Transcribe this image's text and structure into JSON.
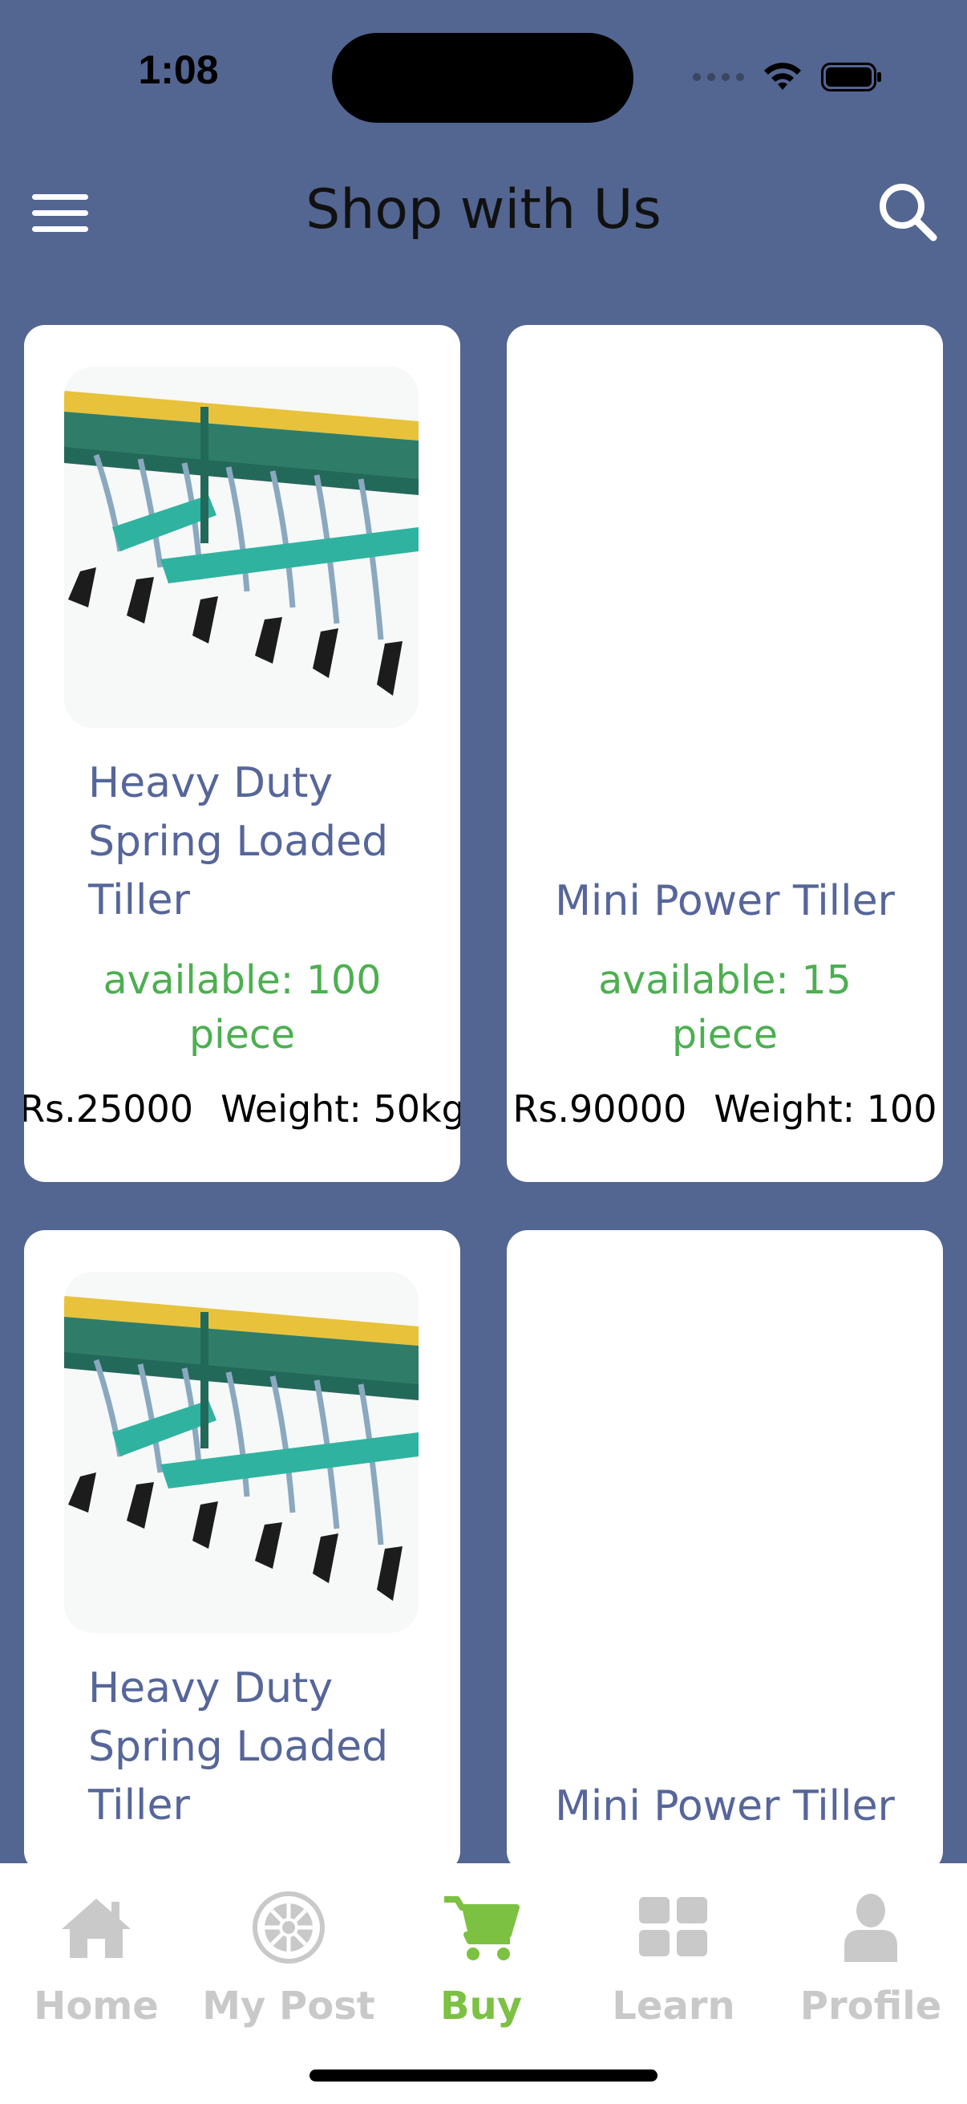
{
  "status_bar": {
    "time": "1:08"
  },
  "header": {
    "title": "Shop with Us",
    "menu_icon": "hamburger-menu-icon",
    "search_icon": "search-icon"
  },
  "products": [
    {
      "title": "Heavy Duty Spring Loaded Tiller",
      "availability": "available: 100 piece",
      "price": "Rs.25000",
      "weight": "Weight: 50kg",
      "has_image": true
    },
    {
      "title": "Mini Power Tiller",
      "availability": "available: 15 piece",
      "price": "Rs.90000",
      "weight": "Weight: 100",
      "has_image": false
    },
    {
      "title": "Heavy Duty Spring Loaded Tiller",
      "has_image": true
    },
    {
      "title": "Mini Power Tiller",
      "has_image": false
    }
  ],
  "bottom_nav": [
    {
      "label": "Home",
      "icon": "home-icon",
      "active": false
    },
    {
      "label": "My Post",
      "icon": "emblem-icon",
      "active": false
    },
    {
      "label": "Buy",
      "icon": "cart-icon",
      "active": true
    },
    {
      "label": "Learn",
      "icon": "grid-icon",
      "active": false
    },
    {
      "label": "Profile",
      "icon": "person-icon",
      "active": false
    }
  ],
  "colors": {
    "background": "#536591",
    "card": "#ffffff",
    "title_text": "#56669a",
    "availability": "#4caf50",
    "nav_active": "#7cc142",
    "nav_inactive": "#c9c9c9"
  }
}
